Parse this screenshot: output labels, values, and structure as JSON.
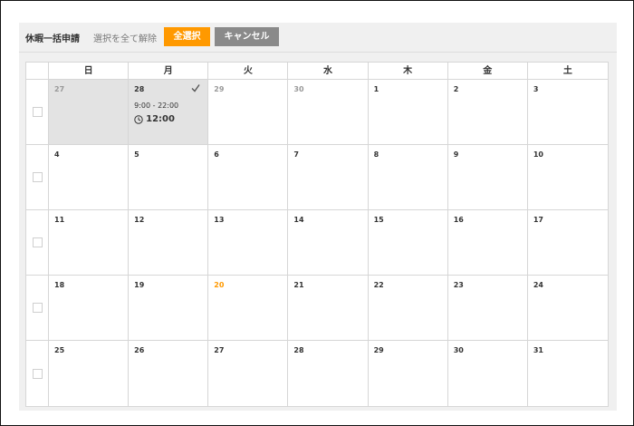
{
  "toolbar": {
    "title": "休暇一括申請",
    "deselect_all": "選択を全て解除",
    "select_all": "全選択",
    "cancel": "キャンセル"
  },
  "colors": {
    "accent": "#ff9900",
    "cancel": "#8a8a8a",
    "selected_bg": "#e3e3e3"
  },
  "weekdays": [
    "日",
    "月",
    "火",
    "水",
    "木",
    "金",
    "土"
  ],
  "weeks": [
    [
      "27",
      "28",
      "29",
      "30",
      "1",
      "2",
      "3"
    ],
    [
      "4",
      "5",
      "6",
      "7",
      "8",
      "9",
      "10"
    ],
    [
      "11",
      "12",
      "13",
      "14",
      "15",
      "16",
      "17"
    ],
    [
      "18",
      "19",
      "20",
      "21",
      "22",
      "23",
      "24"
    ],
    [
      "25",
      "26",
      "27",
      "28",
      "29",
      "30",
      "31"
    ]
  ],
  "selected_day": {
    "week": 0,
    "index": 1,
    "time_range": "9:00 - 22:00",
    "duration": "12:00",
    "icons": [
      "checkmark-icon",
      "clock-icon"
    ]
  }
}
